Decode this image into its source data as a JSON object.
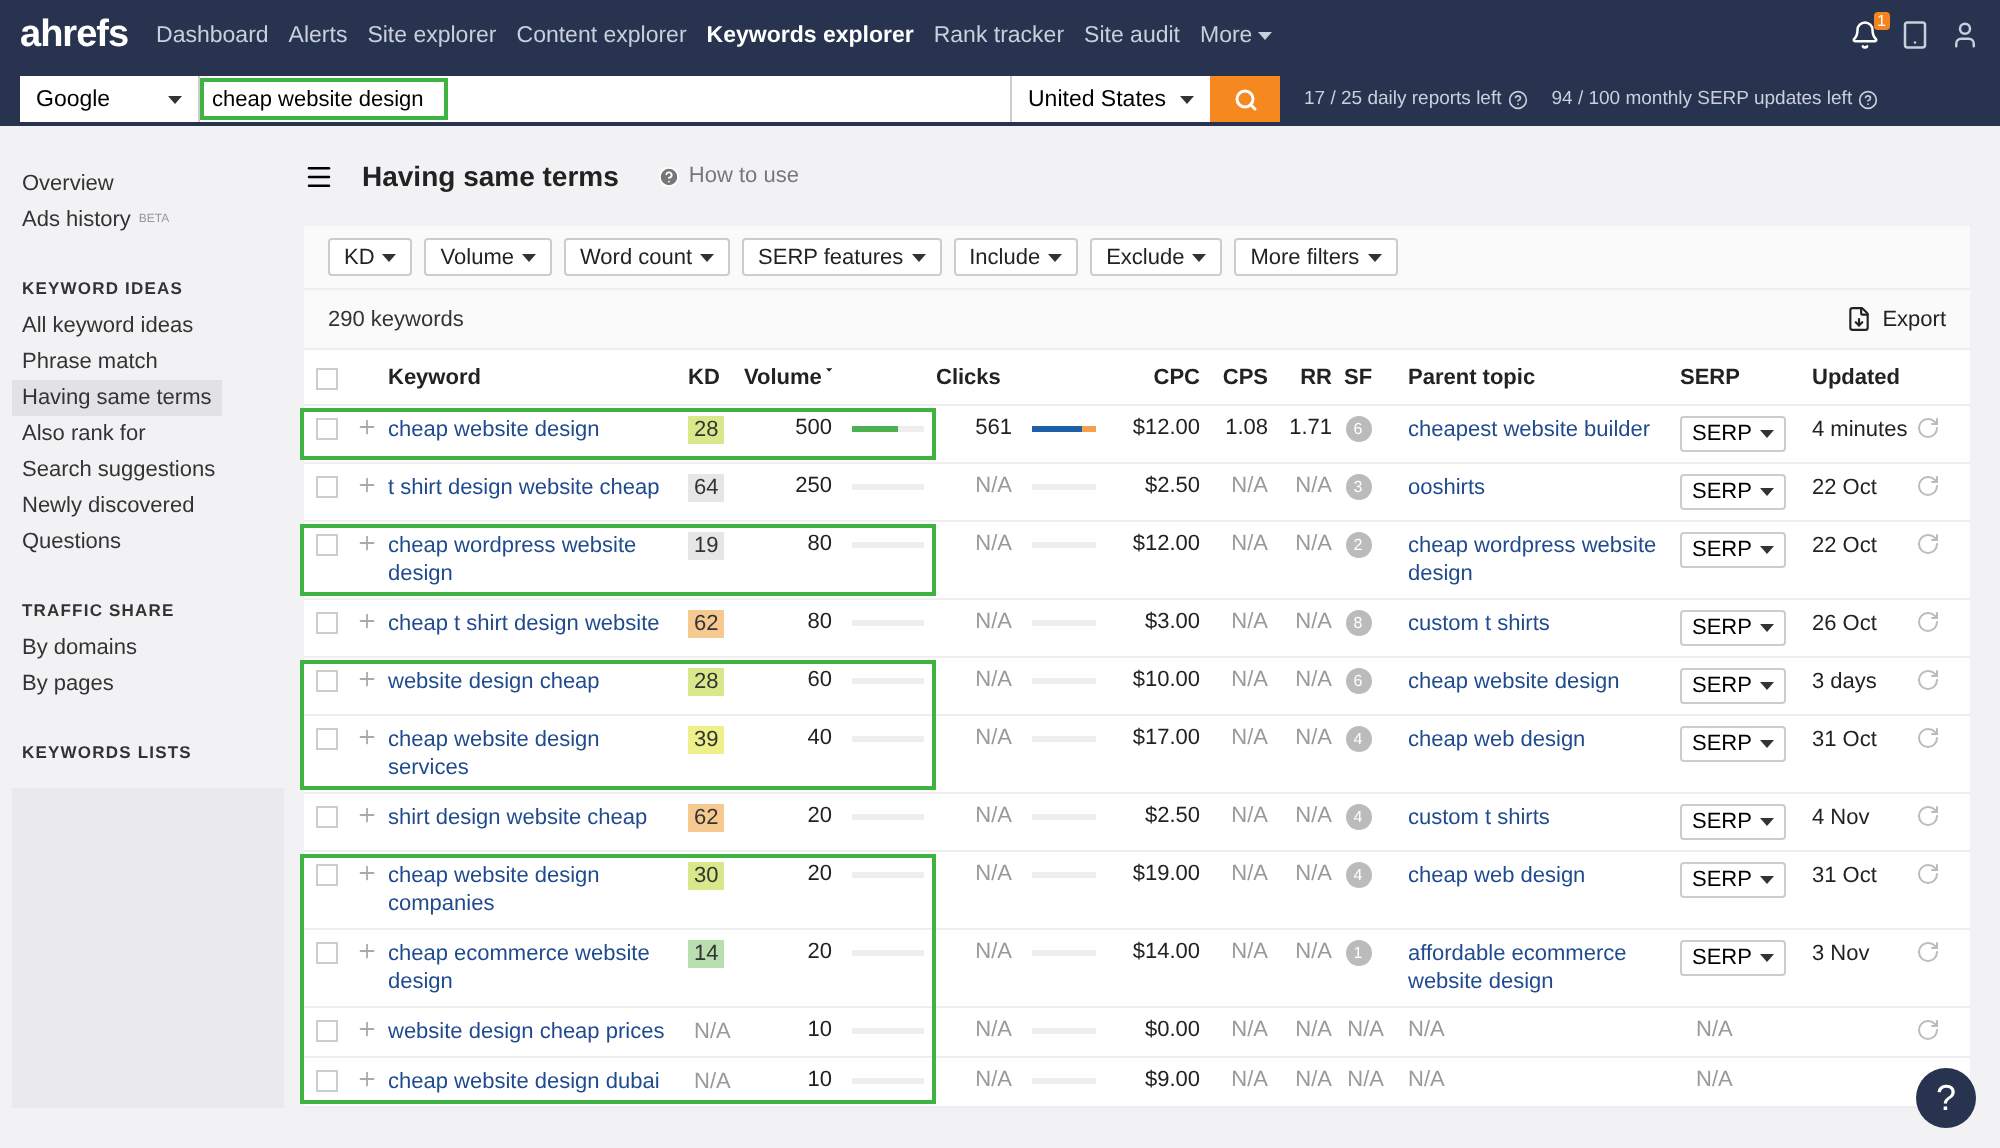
{
  "nav": {
    "logo": "ahrefs",
    "items": [
      {
        "label": "Dashboard",
        "selected": false
      },
      {
        "label": "Alerts",
        "selected": false
      },
      {
        "label": "Site explorer",
        "selected": false
      },
      {
        "label": "Content explorer",
        "selected": false
      },
      {
        "label": "Keywords explorer",
        "selected": true
      },
      {
        "label": "Rank tracker",
        "selected": false
      },
      {
        "label": "Site audit",
        "selected": false
      }
    ],
    "more": "More",
    "notification_count": "1"
  },
  "search": {
    "engine": "Google",
    "query": "cheap website design",
    "highlighted": true,
    "country": "United States",
    "quota": [
      "17 / 25 daily reports left",
      "94 / 100 monthly SERP updates left"
    ]
  },
  "sidebar": {
    "top": [
      {
        "label": "Overview",
        "selected": false
      },
      {
        "label": "Ads history",
        "selected": false,
        "badge": "BETA"
      }
    ],
    "sections": [
      {
        "title": "KEYWORD IDEAS",
        "items": [
          {
            "label": "All keyword ideas",
            "selected": false
          },
          {
            "label": "Phrase match",
            "selected": false
          },
          {
            "label": "Having same terms",
            "selected": true
          },
          {
            "label": "Also rank for",
            "selected": false
          },
          {
            "label": "Search suggestions",
            "selected": false
          },
          {
            "label": "Newly discovered",
            "selected": false
          },
          {
            "label": "Questions",
            "selected": false
          }
        ]
      },
      {
        "title": "TRAFFIC SHARE",
        "items": [
          {
            "label": "By domains",
            "selected": false
          },
          {
            "label": "By pages",
            "selected": false
          }
        ]
      },
      {
        "title": "KEYWORDS LISTS"
      }
    ]
  },
  "page": {
    "title": "Having same terms",
    "help": "How to use"
  },
  "filters": [
    "KD",
    "Volume",
    "Word count",
    "SERP features",
    "Include",
    "Exclude",
    "More filters"
  ],
  "table": {
    "count": "290 keywords",
    "export": "Export",
    "select_all_checked": false,
    "columns": [
      {
        "label": "Keyword",
        "sorted": false
      },
      {
        "label": "KD",
        "sorted": false
      },
      {
        "label": "Volume",
        "sorted": true
      },
      {
        "label": "Clicks",
        "sorted": false
      },
      {
        "label": "CPC",
        "sorted": false
      },
      {
        "label": "CPS",
        "sorted": false
      },
      {
        "label": "RR",
        "sorted": false
      },
      {
        "label": "SF",
        "sorted": false
      },
      {
        "label": "Parent topic",
        "sorted": false
      },
      {
        "label": "SERP",
        "sorted": false
      },
      {
        "label": "Updated",
        "sorted": false
      }
    ],
    "rows": [
      {
        "kind": "full",
        "highlighted": true,
        "checked": false,
        "keyword": "cheap website design",
        "kd": "28",
        "color": "#d9e88a",
        "volume": "500",
        "volume_bar": {
          "level": 0.65
        },
        "clicks": "561",
        "clicks_bar": {
          "level": 0.78
        },
        "cpc": "$12.00",
        "cps": "1.08",
        "rr": "1.71",
        "sf": "6",
        "parent": "cheapest website builder",
        "serp": "SERP",
        "updated": "4 minutes"
      },
      {
        "kind": "partial",
        "highlighted": false,
        "checked": false,
        "keyword": "t shirt design website cheap",
        "kd": "64",
        "color": "#e6e6e6",
        "volume": "250",
        "clicks": "N/A",
        "cpc": "$2.50",
        "cps": "N/A",
        "rr": "N/A",
        "sf": "3",
        "parent": "ooshirts",
        "serp": "SERP",
        "updated": "22 Oct"
      },
      {
        "kind": "partial",
        "highlighted": true,
        "checked": false,
        "keyword": "cheap wordpress website design",
        "kd": "19",
        "color": "#e6e6e6",
        "volume": "80",
        "clicks": "N/A",
        "cpc": "$12.00",
        "cps": "N/A",
        "rr": "N/A",
        "sf": "2",
        "parent": "cheap wordpress website design",
        "serp": "SERP",
        "updated": "22 Oct"
      },
      {
        "kind": "partial",
        "highlighted": false,
        "checked": false,
        "keyword": "cheap t shirt design website",
        "kd": "62",
        "color": "#f5c98f",
        "volume": "80",
        "clicks": "N/A",
        "cpc": "$3.00",
        "cps": "N/A",
        "rr": "N/A",
        "sf": "8",
        "parent": "custom t shirts",
        "serp": "SERP",
        "updated": "26 Oct"
      },
      {
        "kind": "partial",
        "highlighted": true,
        "checked": false,
        "keyword": "website design cheap",
        "kd": "28",
        "color": "#d9e88a",
        "volume": "60",
        "clicks": "N/A",
        "cpc": "$10.00",
        "cps": "N/A",
        "rr": "N/A",
        "sf": "6",
        "parent": "cheap website design",
        "serp": "SERP",
        "updated": "3 days"
      },
      {
        "kind": "partial",
        "highlighted": true,
        "checked": false,
        "keyword": "cheap website design services",
        "kd": "39",
        "color": "#eef08a",
        "volume": "40",
        "clicks": "N/A",
        "cpc": "$17.00",
        "cps": "N/A",
        "rr": "N/A",
        "sf": "4",
        "parent": "cheap web design",
        "serp": "SERP",
        "updated": "31 Oct"
      },
      {
        "kind": "partial",
        "highlighted": false,
        "checked": false,
        "keyword": "shirt design website cheap",
        "kd": "62",
        "color": "#f5c98f",
        "volume": "20",
        "clicks": "N/A",
        "cpc": "$2.50",
        "cps": "N/A",
        "rr": "N/A",
        "sf": "4",
        "parent": "custom t shirts",
        "serp": "SERP",
        "updated": "4 Nov"
      },
      {
        "kind": "partial",
        "highlighted": true,
        "checked": false,
        "keyword": "cheap website design companies",
        "kd": "30",
        "color": "#d9e88a",
        "volume": "20",
        "clicks": "N/A",
        "cpc": "$19.00",
        "cps": "N/A",
        "rr": "N/A",
        "sf": "4",
        "parent": "cheap web design",
        "serp": "SERP",
        "updated": "31 Oct"
      },
      {
        "kind": "partial",
        "highlighted": true,
        "checked": false,
        "keyword": "cheap ecommerce website design",
        "kd": "14",
        "color": "#b9deb0",
        "volume": "20",
        "clicks": "N/A",
        "cpc": "$14.00",
        "cps": "N/A",
        "rr": "N/A",
        "sf": "1",
        "parent": "affordable ecommerce website design",
        "serp": "SERP",
        "updated": "3 Nov"
      },
      {
        "kind": "empty",
        "highlighted": true,
        "checked": false,
        "keyword": "website design cheap prices",
        "kd": "N/A",
        "volume": "10",
        "clicks": "N/A",
        "cpc": "$0.00",
        "cps": "N/A",
        "rr": "N/A",
        "sf": "N/A",
        "parent": "N/A",
        "serp": "N/A"
      },
      {
        "kind": "empty",
        "highlighted": true,
        "checked": false,
        "keyword": "cheap website design dubai",
        "kd": "N/A",
        "volume": "10",
        "clicks": "N/A",
        "cpc": "$9.00",
        "cps": "N/A",
        "rr": "N/A",
        "sf": "N/A",
        "parent": "N/A",
        "serp": "N/A",
        "refresh": false
      }
    ]
  },
  "help_button": "?"
}
